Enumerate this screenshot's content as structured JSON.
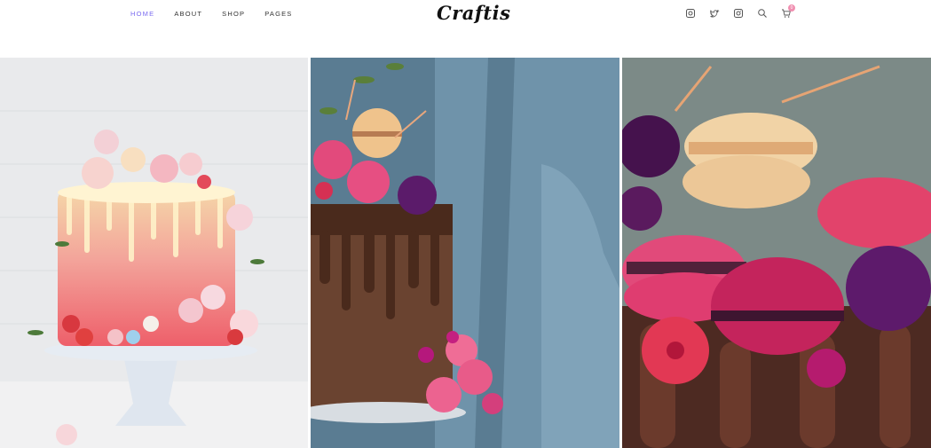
{
  "nav": {
    "items": [
      {
        "label": "HOME",
        "active": true
      },
      {
        "label": "ABOUT",
        "active": false
      },
      {
        "label": "SHOP",
        "active": false
      },
      {
        "label": "PAGES",
        "active": false
      }
    ]
  },
  "logo": {
    "text": "Craftis"
  },
  "header_icons": [
    "instagram-icon",
    "twitter-icon",
    "instagram-icon",
    "search-icon",
    "cart-icon"
  ],
  "cart": {
    "count": "0"
  },
  "gallery": {
    "images": [
      {
        "subject": "drip cake with flowers and macarons on white cake stand"
      },
      {
        "subject": "chocolate drip cake with pink macarons held in hands"
      },
      {
        "subject": "close-up of pink macarons and raspberries on chocolate cake"
      }
    ]
  },
  "colors": {
    "accent": "#7b6cf0",
    "badge": "#f08fb0",
    "text": "#333333"
  }
}
